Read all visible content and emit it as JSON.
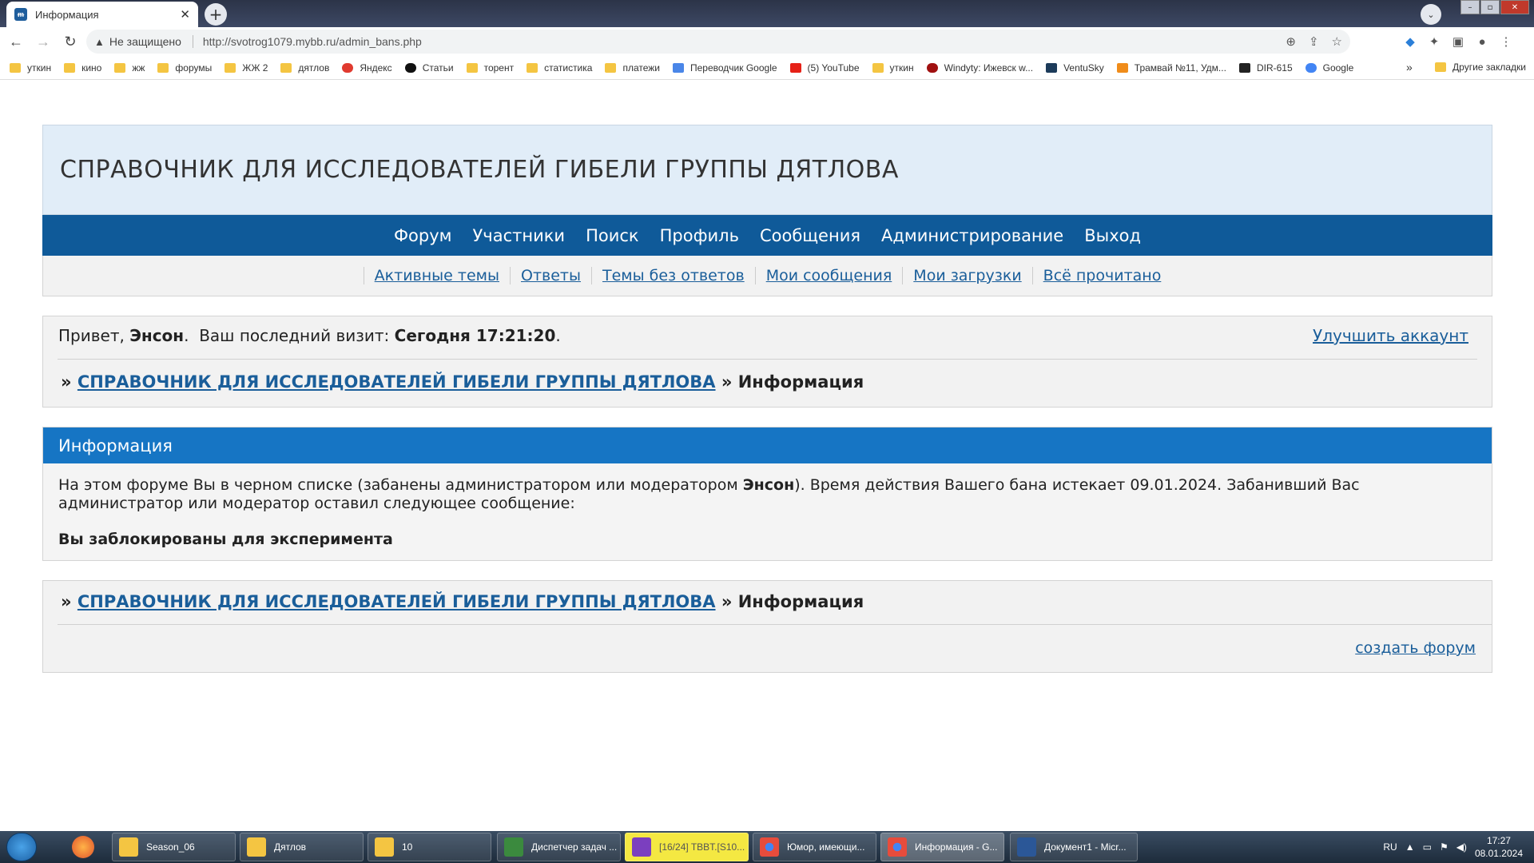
{
  "browser": {
    "tab_title": "Информация",
    "tab_close": "✕",
    "new_tab": "+",
    "security_label": "Не защищено",
    "url": "http://svotrog1079.mybb.ru/admin_bans.php",
    "bookmarks": [
      {
        "label": "уткин",
        "icon": "folder"
      },
      {
        "label": "кино",
        "icon": "folder"
      },
      {
        "label": "жж",
        "icon": "folder"
      },
      {
        "label": "форумы",
        "icon": "folder"
      },
      {
        "label": "ЖЖ 2",
        "icon": "folder"
      },
      {
        "label": "дятлов",
        "icon": "folder"
      },
      {
        "label": "Яндекс",
        "icon": "yandex"
      },
      {
        "label": "Статьи",
        "icon": "black-circle"
      },
      {
        "label": "торент",
        "icon": "folder"
      },
      {
        "label": "статистика",
        "icon": "folder"
      },
      {
        "label": "платежи",
        "icon": "folder"
      },
      {
        "label": "Переводчик Google",
        "icon": "translate"
      },
      {
        "label": "(5) YouTube",
        "icon": "youtube"
      },
      {
        "label": "уткин",
        "icon": "folder"
      },
      {
        "label": "Windyty: Ижевск w...",
        "icon": "windy"
      },
      {
        "label": "VentuSky",
        "icon": "ventusky"
      },
      {
        "label": "Трамвай №11, Удм...",
        "icon": "tram"
      },
      {
        "label": "DIR-615",
        "icon": "dlink"
      },
      {
        "label": "Google",
        "icon": "google"
      }
    ],
    "bookmarks_more": "»",
    "other_bookmarks": "Другие закладки"
  },
  "forum": {
    "title": "СПРАВОЧНИК ДЛЯ ИССЛЕДОВАТЕЛЕЙ ГИБЕЛИ ГРУППЫ ДЯТЛОВА",
    "main_nav": [
      "Форум",
      "Участники",
      "Поиск",
      "Профиль",
      "Сообщения",
      "Администрирование",
      "Выход"
    ],
    "sub_nav": [
      "Активные темы",
      "Ответы",
      "Темы без ответов",
      "Мои сообщения",
      "Мои загрузки",
      "Всё прочитано"
    ],
    "greeting_prefix": "Привет, ",
    "username": "Энсон",
    "greeting_mid": ".  Ваш последний визит: ",
    "last_visit": "Сегодня 17:21:20",
    "greeting_end": ".",
    "upgrade_link": "Улучшить аккаунт",
    "breadcrumb_sep": "» ",
    "breadcrumb_home": "СПРАВОЧНИК ДЛЯ ИССЛЕДОВАТЕЛЕЙ ГИБЕЛИ ГРУППЫ ДЯТЛОВА",
    "breadcrumb_sep2": " » ",
    "breadcrumb_current": "Информация",
    "info_title": "Информация",
    "info_text_1": "На этом форуме Вы в черном списке (забанены администратором или модератором ",
    "info_moderator": "Энсон",
    "info_text_2": "). Время действия Вашего бана истекает 09.01.2024. Забанивший Вас администратор или модератор оставил следующее сообщение:",
    "ban_message": "Вы заблокированы для эксперимента",
    "create_forum": "создать форум"
  },
  "taskbar": {
    "tasks": [
      {
        "label": "Season_06",
        "color": "#f4c542"
      },
      {
        "label": "Дятлов",
        "color": "#f4c542"
      },
      {
        "label": "10",
        "color": "#f4c542"
      },
      {
        "label": "Диспетчер задач ...",
        "color": "#3b8a3e"
      },
      {
        "label": "[16/24] TBBT.[S10...",
        "color": "#7b3fbf"
      },
      {
        "label": "Юмор, имеющи...",
        "color": "#e74c3c"
      },
      {
        "label": "Информация - G...",
        "color": "#e74c3c"
      },
      {
        "label": "Документ1 - Micr...",
        "color": "#2b5797"
      }
    ],
    "lang": "RU",
    "time": "17:27",
    "date": "08.01.2024"
  }
}
